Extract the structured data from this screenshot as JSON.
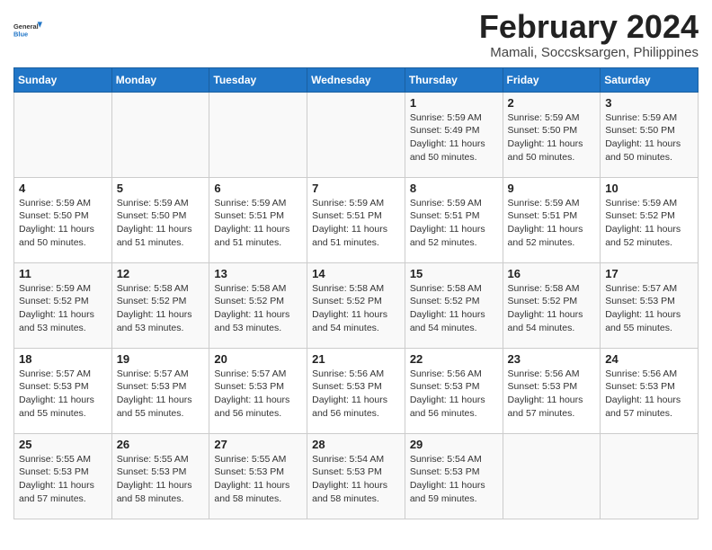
{
  "header": {
    "logo_line1": "General",
    "logo_line2": "Blue",
    "month_year": "February 2024",
    "location": "Mamali, Soccsksargen, Philippines"
  },
  "weekdays": [
    "Sunday",
    "Monday",
    "Tuesday",
    "Wednesday",
    "Thursday",
    "Friday",
    "Saturday"
  ],
  "weeks": [
    [
      {
        "day": "",
        "info": ""
      },
      {
        "day": "",
        "info": ""
      },
      {
        "day": "",
        "info": ""
      },
      {
        "day": "",
        "info": ""
      },
      {
        "day": "1",
        "info": "Sunrise: 5:59 AM\nSunset: 5:49 PM\nDaylight: 11 hours\nand 50 minutes."
      },
      {
        "day": "2",
        "info": "Sunrise: 5:59 AM\nSunset: 5:50 PM\nDaylight: 11 hours\nand 50 minutes."
      },
      {
        "day": "3",
        "info": "Sunrise: 5:59 AM\nSunset: 5:50 PM\nDaylight: 11 hours\nand 50 minutes."
      }
    ],
    [
      {
        "day": "4",
        "info": "Sunrise: 5:59 AM\nSunset: 5:50 PM\nDaylight: 11 hours\nand 50 minutes."
      },
      {
        "day": "5",
        "info": "Sunrise: 5:59 AM\nSunset: 5:50 PM\nDaylight: 11 hours\nand 51 minutes."
      },
      {
        "day": "6",
        "info": "Sunrise: 5:59 AM\nSunset: 5:51 PM\nDaylight: 11 hours\nand 51 minutes."
      },
      {
        "day": "7",
        "info": "Sunrise: 5:59 AM\nSunset: 5:51 PM\nDaylight: 11 hours\nand 51 minutes."
      },
      {
        "day": "8",
        "info": "Sunrise: 5:59 AM\nSunset: 5:51 PM\nDaylight: 11 hours\nand 52 minutes."
      },
      {
        "day": "9",
        "info": "Sunrise: 5:59 AM\nSunset: 5:51 PM\nDaylight: 11 hours\nand 52 minutes."
      },
      {
        "day": "10",
        "info": "Sunrise: 5:59 AM\nSunset: 5:52 PM\nDaylight: 11 hours\nand 52 minutes."
      }
    ],
    [
      {
        "day": "11",
        "info": "Sunrise: 5:59 AM\nSunset: 5:52 PM\nDaylight: 11 hours\nand 53 minutes."
      },
      {
        "day": "12",
        "info": "Sunrise: 5:58 AM\nSunset: 5:52 PM\nDaylight: 11 hours\nand 53 minutes."
      },
      {
        "day": "13",
        "info": "Sunrise: 5:58 AM\nSunset: 5:52 PM\nDaylight: 11 hours\nand 53 minutes."
      },
      {
        "day": "14",
        "info": "Sunrise: 5:58 AM\nSunset: 5:52 PM\nDaylight: 11 hours\nand 54 minutes."
      },
      {
        "day": "15",
        "info": "Sunrise: 5:58 AM\nSunset: 5:52 PM\nDaylight: 11 hours\nand 54 minutes."
      },
      {
        "day": "16",
        "info": "Sunrise: 5:58 AM\nSunset: 5:52 PM\nDaylight: 11 hours\nand 54 minutes."
      },
      {
        "day": "17",
        "info": "Sunrise: 5:57 AM\nSunset: 5:53 PM\nDaylight: 11 hours\nand 55 minutes."
      }
    ],
    [
      {
        "day": "18",
        "info": "Sunrise: 5:57 AM\nSunset: 5:53 PM\nDaylight: 11 hours\nand 55 minutes."
      },
      {
        "day": "19",
        "info": "Sunrise: 5:57 AM\nSunset: 5:53 PM\nDaylight: 11 hours\nand 55 minutes."
      },
      {
        "day": "20",
        "info": "Sunrise: 5:57 AM\nSunset: 5:53 PM\nDaylight: 11 hours\nand 56 minutes."
      },
      {
        "day": "21",
        "info": "Sunrise: 5:56 AM\nSunset: 5:53 PM\nDaylight: 11 hours\nand 56 minutes."
      },
      {
        "day": "22",
        "info": "Sunrise: 5:56 AM\nSunset: 5:53 PM\nDaylight: 11 hours\nand 56 minutes."
      },
      {
        "day": "23",
        "info": "Sunrise: 5:56 AM\nSunset: 5:53 PM\nDaylight: 11 hours\nand 57 minutes."
      },
      {
        "day": "24",
        "info": "Sunrise: 5:56 AM\nSunset: 5:53 PM\nDaylight: 11 hours\nand 57 minutes."
      }
    ],
    [
      {
        "day": "25",
        "info": "Sunrise: 5:55 AM\nSunset: 5:53 PM\nDaylight: 11 hours\nand 57 minutes."
      },
      {
        "day": "26",
        "info": "Sunrise: 5:55 AM\nSunset: 5:53 PM\nDaylight: 11 hours\nand 58 minutes."
      },
      {
        "day": "27",
        "info": "Sunrise: 5:55 AM\nSunset: 5:53 PM\nDaylight: 11 hours\nand 58 minutes."
      },
      {
        "day": "28",
        "info": "Sunrise: 5:54 AM\nSunset: 5:53 PM\nDaylight: 11 hours\nand 58 minutes."
      },
      {
        "day": "29",
        "info": "Sunrise: 5:54 AM\nSunset: 5:53 PM\nDaylight: 11 hours\nand 59 minutes."
      },
      {
        "day": "",
        "info": ""
      },
      {
        "day": "",
        "info": ""
      }
    ]
  ]
}
